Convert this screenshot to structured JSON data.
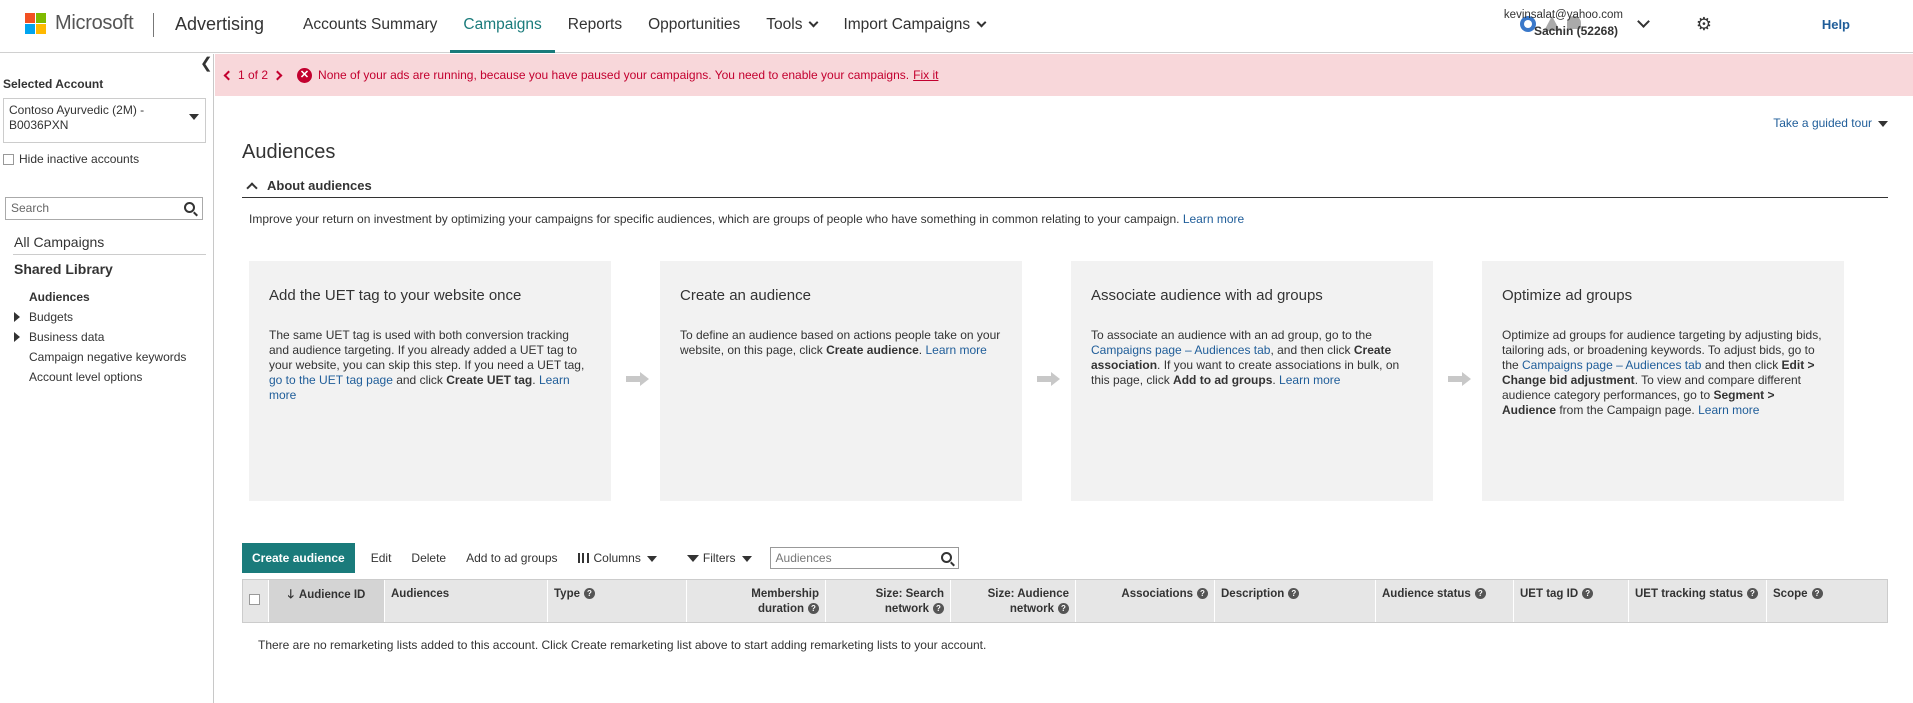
{
  "header": {
    "brand": "Microsoft",
    "product": "Advertising",
    "nav": [
      {
        "label": "Accounts Summary",
        "active": false
      },
      {
        "label": "Campaigns",
        "active": true
      },
      {
        "label": "Reports",
        "active": false
      },
      {
        "label": "Opportunities",
        "active": false
      },
      {
        "label": "Tools",
        "active": false,
        "dropdown": true
      },
      {
        "label": "Import Campaigns",
        "active": false,
        "dropdown": true
      }
    ],
    "user_email": "kevinsalat@yahoo.com",
    "user_name": "Sachin (52268)",
    "help": "Help",
    "colors": {
      "accent": "#1a7b7b",
      "link": "#1f5d99",
      "alert_bg": "#f8d7da",
      "alert_text": "#c3002f"
    }
  },
  "sidebar": {
    "selected_account_label": "Selected Account",
    "account": "Contoso Ayurvedic (2M) - B0036PXN",
    "hide_inactive": "Hide inactive accounts",
    "search_placeholder": "Search",
    "all_campaigns": "All Campaigns",
    "shared_library": "Shared Library",
    "items": [
      {
        "label": "Audiences",
        "expandable": false,
        "selected": true
      },
      {
        "label": "Budgets",
        "expandable": true
      },
      {
        "label": "Business data",
        "expandable": true
      },
      {
        "label": "Campaign negative keywords",
        "expandable": false
      },
      {
        "label": "Account level options",
        "expandable": false
      }
    ]
  },
  "alert": {
    "pager": "1 of 2",
    "message": "None of your ads are running, because you have paused your campaigns. You need to enable your campaigns.",
    "fix": "Fix it"
  },
  "main": {
    "tour": "Take a guided tour",
    "title": "Audiences",
    "about_title": "About audiences",
    "about_desc": "Improve your return on investment by optimizing your campaigns for specific audiences, which are groups of people who have something in common relating to your campaign.",
    "learn_more": "Learn more",
    "cards": [
      {
        "title": "Add the UET tag to your website once",
        "t1": "The same UET tag is used with both conversion tracking and audience targeting. If you already added a UET tag to your website, you can skip this step. If you need a UET tag, ",
        "link1": "go to the UET tag page",
        "t2": " and click ",
        "b1": "Create UET tag",
        "t3": ". ",
        "learn": "Learn more"
      },
      {
        "title": "Create an audience",
        "t1": "To define an audience based on actions people take on your website, on this page, click ",
        "b1": "Create audience",
        "t2": ". ",
        "learn": "Learn more"
      },
      {
        "title": "Associate audience with ad groups",
        "t1": "To associate an audience with an ad group, go to the ",
        "link1": "Campaigns page – Audiences tab",
        "t2": ", and then click ",
        "b1": "Create association",
        "t3": ". If you want to create associations in bulk, on this page, click ",
        "b2": "Add to ad groups",
        "t4": ". ",
        "learn": "Learn more"
      },
      {
        "title": "Optimize ad groups",
        "t1": "Optimize ad groups for audience targeting by adjusting bids, tailoring ads, or broadening keywords. To adjust bids, go to the ",
        "link1": "Campaigns page – Audiences tab",
        "t2": " and then click ",
        "b1": "Edit > Change bid adjustment",
        "t3": ". To view and compare different audience category performances, go to ",
        "b2": "Segment > Audience",
        "t4": " from the Campaign page. ",
        "learn": "Learn more"
      }
    ],
    "toolbar": {
      "create": "Create audience",
      "edit": "Edit",
      "delete": "Delete",
      "add": "Add to ad groups",
      "columns": "Columns",
      "filters": "Filters",
      "search_placeholder": "Audiences"
    },
    "table": {
      "columns": [
        {
          "label": "Audience ID",
          "help": true,
          "sorted": true
        },
        {
          "label": "Audiences",
          "help": false
        },
        {
          "label": "Type",
          "help": true
        },
        {
          "label": "Membership duration",
          "help": true
        },
        {
          "label": "Size: Search network",
          "help": true
        },
        {
          "label": "Size: Audience network",
          "help": true
        },
        {
          "label": "Associations",
          "help": true
        },
        {
          "label": "Description",
          "help": true
        },
        {
          "label": "Audience status",
          "help": true
        },
        {
          "label": "UET tag ID",
          "help": true
        },
        {
          "label": "UET tracking status",
          "help": true
        },
        {
          "label": "Scope",
          "help": true
        }
      ],
      "empty": "There are no remarketing lists added to this account. Click Create remarketing list above to start adding remarketing lists to your account."
    }
  }
}
